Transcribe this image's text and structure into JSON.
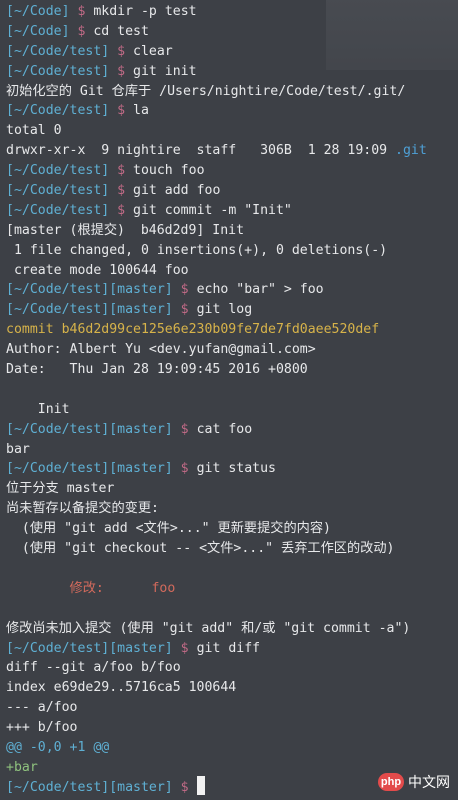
{
  "terminal": {
    "lines": [
      [
        {
          "t": "[~/Code] ",
          "c": "p"
        },
        {
          "t": "$ ",
          "c": "d"
        },
        {
          "t": "mkdir -p test",
          "c": "w"
        }
      ],
      [
        {
          "t": "[~/Code] ",
          "c": "p"
        },
        {
          "t": "$ ",
          "c": "d"
        },
        {
          "t": "cd test",
          "c": "w"
        }
      ],
      [
        {
          "t": "[~/Code/test] ",
          "c": "p"
        },
        {
          "t": "$ ",
          "c": "d"
        },
        {
          "t": "clear",
          "c": "w"
        }
      ],
      [
        {
          "t": "[~/Code/test] ",
          "c": "p"
        },
        {
          "t": "$ ",
          "c": "d"
        },
        {
          "t": "git init",
          "c": "w"
        }
      ],
      [
        {
          "t": "初始化空的 Git 仓库于 /Users/nightire/Code/test/.git/",
          "c": "w"
        }
      ],
      [
        {
          "t": "[~/Code/test] ",
          "c": "p"
        },
        {
          "t": "$ ",
          "c": "d"
        },
        {
          "t": "la",
          "c": "w"
        }
      ],
      [
        {
          "t": "total 0",
          "c": "w"
        }
      ],
      [
        {
          "t": "drwxr-xr-x  9 nightire  staff   306B  1 28 19:09 ",
          "c": "w"
        },
        {
          "t": ".git",
          "c": "b"
        }
      ],
      [
        {
          "t": "[~/Code/test] ",
          "c": "p"
        },
        {
          "t": "$ ",
          "c": "d"
        },
        {
          "t": "touch foo",
          "c": "w"
        }
      ],
      [
        {
          "t": "[~/Code/test] ",
          "c": "p"
        },
        {
          "t": "$ ",
          "c": "d"
        },
        {
          "t": "git add foo",
          "c": "w"
        }
      ],
      [
        {
          "t": "[~/Code/test] ",
          "c": "p"
        },
        {
          "t": "$ ",
          "c": "d"
        },
        {
          "t": "git commit -m \"Init\"",
          "c": "w"
        }
      ],
      [
        {
          "t": "[master (根提交)  b46d2d9] Init",
          "c": "w"
        }
      ],
      [
        {
          "t": " 1 file changed, 0 insertions(+), 0 deletions(-)",
          "c": "w"
        }
      ],
      [
        {
          "t": " create mode 100644 foo",
          "c": "w"
        }
      ],
      [
        {
          "t": "[~/Code/test][master] ",
          "c": "p"
        },
        {
          "t": "$ ",
          "c": "d"
        },
        {
          "t": "echo \"bar\" > foo",
          "c": "w"
        }
      ],
      [
        {
          "t": "[~/Code/test][master] ",
          "c": "p"
        },
        {
          "t": "$ ",
          "c": "d"
        },
        {
          "t": "git log",
          "c": "w"
        }
      ],
      [
        {
          "t": "commit b46d2d99ce125e6e230b09fe7de7fd0aee520def",
          "c": "y"
        }
      ],
      [
        {
          "t": "Author: Albert Yu <dev.yufan@gmail.com>",
          "c": "w"
        }
      ],
      [
        {
          "t": "Date:   Thu Jan 28 19:09:45 2016 +0800",
          "c": "w"
        }
      ],
      [
        {
          "t": "",
          "c": "w"
        }
      ],
      [
        {
          "t": "    Init",
          "c": "w"
        }
      ],
      [
        {
          "t": "[~/Code/test][master] ",
          "c": "p"
        },
        {
          "t": "$ ",
          "c": "d"
        },
        {
          "t": "cat foo",
          "c": "w"
        }
      ],
      [
        {
          "t": "bar",
          "c": "w"
        }
      ],
      [
        {
          "t": "[~/Code/test][master] ",
          "c": "p"
        },
        {
          "t": "$ ",
          "c": "d"
        },
        {
          "t": "git status",
          "c": "w"
        }
      ],
      [
        {
          "t": "位于分支 master",
          "c": "w"
        }
      ],
      [
        {
          "t": "尚未暂存以备提交的变更:",
          "c": "w"
        }
      ],
      [
        {
          "t": "  (使用 \"git add <文件>...\" 更新要提交的内容)",
          "c": "w"
        }
      ],
      [
        {
          "t": "  (使用 \"git checkout -- <文件>...\" 丢弃工作区的改动)",
          "c": "w"
        }
      ],
      [
        {
          "t": "",
          "c": "w"
        }
      ],
      [
        {
          "t": "        修改:      foo",
          "c": "r"
        }
      ],
      [
        {
          "t": "",
          "c": "w"
        }
      ],
      [
        {
          "t": "修改尚未加入提交 (使用 \"git add\" 和/或 \"git commit -a\")",
          "c": "w"
        }
      ],
      [
        {
          "t": "[~/Code/test][master] ",
          "c": "p"
        },
        {
          "t": "$ ",
          "c": "d"
        },
        {
          "t": "git diff",
          "c": "w"
        }
      ],
      [
        {
          "t": "diff --git a/foo b/foo",
          "c": "w"
        }
      ],
      [
        {
          "t": "index e69de29..5716ca5 100644",
          "c": "w"
        }
      ],
      [
        {
          "t": "--- a/foo",
          "c": "w"
        }
      ],
      [
        {
          "t": "+++ b/foo",
          "c": "w"
        }
      ],
      [
        {
          "t": "@@ -0,0 +1 @@",
          "c": "p"
        }
      ],
      [
        {
          "t": "+bar",
          "c": "g"
        }
      ],
      [
        {
          "t": "[~/Code/test][master] ",
          "c": "p"
        },
        {
          "t": "$ ",
          "c": "d"
        }
      ]
    ]
  },
  "colors": {
    "background": "#3d4046",
    "prompt": "#5fb0d4",
    "dollar": "#c06a86",
    "commit_hash": "#d7b34a",
    "modified": "#d26a5c",
    "added": "#8fc27e",
    "directory": "#4ea0d6"
  },
  "watermark": {
    "logo": "php",
    "text": "中文网"
  }
}
